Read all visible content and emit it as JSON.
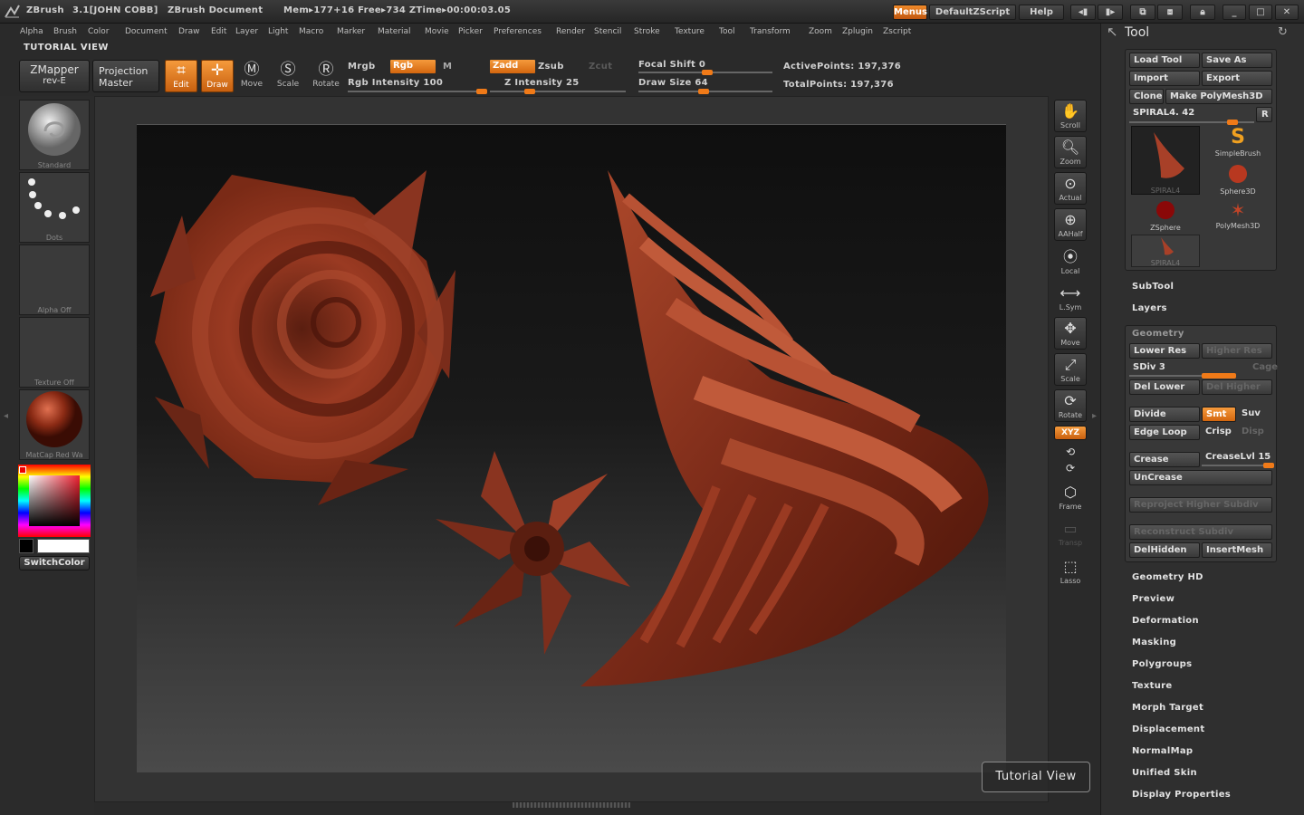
{
  "titlebar": {
    "app": "ZBrush",
    "version": "3.1[JOHN COBB]",
    "document": "ZBrush Document",
    "mem": "Mem▸177+16  Free▸734  ZTime▸00:00:03.05",
    "menus_label": "Menus",
    "script_label": "DefaultZScript",
    "help_label": "Help"
  },
  "menubar": {
    "items": [
      "Alpha",
      "Brush",
      "Color",
      "Document",
      "Draw",
      "Edit",
      "Layer",
      "Light",
      "Macro",
      "Marker",
      "Material",
      "Movie",
      "Picker",
      "Preferences",
      "Render",
      "Stencil",
      "Stroke",
      "Texture",
      "Tool",
      "Transform",
      "Zoom",
      "Zplugin",
      "Zscript"
    ]
  },
  "tutorial_label": "TUTORIAL VIEW",
  "shelf": {
    "zmapper_line1": "ZMapper",
    "zmapper_line2": "rev-E",
    "projection_line1": "Projection",
    "projection_line2": "Master",
    "edit": "Edit",
    "draw": "Draw",
    "move": "Move",
    "scale": "Scale",
    "rotate": "Rotate",
    "mrgb": "Mrgb",
    "rgb": "Rgb",
    "m": "M",
    "rgb_intensity": "Rgb Intensity 100",
    "zadd": "Zadd",
    "zsub": "Zsub",
    "zcut": "Zcut",
    "z_intensity": "Z Intensity 25",
    "focal_shift": "Focal Shift 0",
    "draw_size": "Draw Size 64",
    "active_points": "ActivePoints: 197,376",
    "total_points": "TotalPoints: 197,376"
  },
  "left": {
    "brush": "Standard",
    "stroke": "Dots",
    "alpha": "Alpha  Off",
    "texture": "Texture  Off",
    "material": "MatCap Red Wa",
    "switch_color": "SwitchColor"
  },
  "right_shelf": {
    "scroll": "Scroll",
    "zoom": "Zoom",
    "actual": "Actual",
    "aahalf": "AAHalf",
    "local": "Local",
    "lsym": "L.Sym",
    "move": "Move",
    "scale": "Scale",
    "rotate": "Rotate",
    "xyz": "XYZ",
    "frame": "Frame",
    "transp": "Transp",
    "lasso": "Lasso"
  },
  "tutorial_view": "Tutorial View",
  "tool_panel": {
    "title": "Tool",
    "load_tool": "Load Tool",
    "save_as": "Save As",
    "import": "Import",
    "export": "Export",
    "clone": "Clone",
    "make_polymesh": "Make PolyMesh3D",
    "current_tool": "SPIRAL4. 42",
    "r_label": "R",
    "tools": [
      "SPIRAL4",
      "SimpleBrush",
      "Sphere3D",
      "ZSphere",
      "PolyMesh3D",
      "SPIRAL4"
    ],
    "subtool": "SubTool",
    "layers": "Layers",
    "geometry": "Geometry",
    "lower_res": "Lower Res",
    "higher_res": "Higher Res",
    "sdiv": "SDiv 3",
    "cage": "Cage",
    "del_lower": "Del Lower",
    "del_higher": "Del Higher",
    "divide": "Divide",
    "smt": "Smt",
    "suv": "Suv",
    "edge_loop": "Edge Loop",
    "crisp": "Crisp",
    "disp": "Disp",
    "crease": "Crease",
    "crease_lvl": "CreaseLvl 15",
    "uncrease": "UnCrease",
    "reproject": "Reproject Higher Subdiv",
    "reconstruct": "Reconstruct Subdiv",
    "del_hidden": "DelHidden",
    "insert_mesh": "InsertMesh",
    "sections": [
      "Geometry HD",
      "Preview",
      "Deformation",
      "Masking",
      "Polygroups",
      "Texture",
      "Morph Target",
      "Displacement",
      "NormalMap",
      "Unified Skin",
      "Display Properties"
    ]
  },
  "colors": {
    "accent": "#e8761a",
    "model": "#8a3320"
  }
}
